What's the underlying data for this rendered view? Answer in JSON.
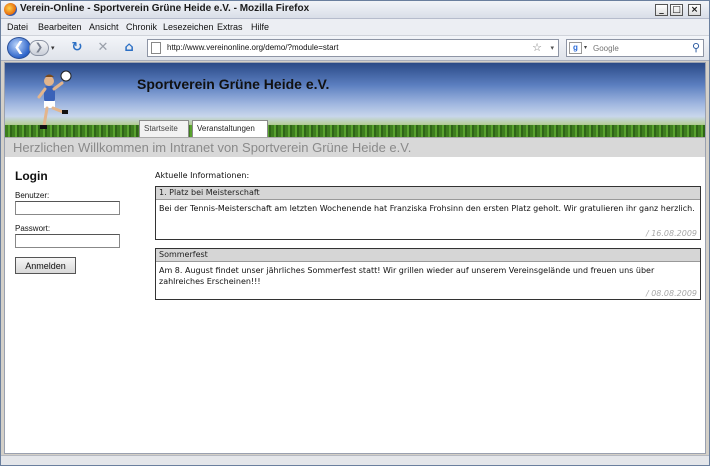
{
  "window": {
    "title": "Verein-Online - Sportverein Grüne Heide e.V. - Mozilla Firefox",
    "controls": {
      "minimize": "_",
      "maximize": "□",
      "close": "×"
    }
  },
  "menu": {
    "items": [
      {
        "label": "Datei"
      },
      {
        "label": "Bearbeiten"
      },
      {
        "label": "Ansicht"
      },
      {
        "label": "Chronik"
      },
      {
        "label": "Lesezeichen"
      },
      {
        "label": "Extras"
      },
      {
        "label": "Hilfe"
      }
    ]
  },
  "toolbar": {
    "back": "❮",
    "forward": "❯",
    "history": "▾",
    "reload": "↻",
    "stop": "✕",
    "home": "⌂",
    "url": "http://www.vereinonline.org/demo/?module=start",
    "bookmark_star": "☆",
    "url_dropdown": "▾",
    "search_engine": "g",
    "search_dropdown": "▾",
    "search_placeholder": "Google",
    "search_icon": "⚲"
  },
  "site": {
    "title": "Sportverein Grüne Heide e.V.",
    "tabs": [
      {
        "label": "Startseite"
      },
      {
        "label": "Veranstaltungen",
        "active": true
      }
    ],
    "welcome": "Herzlichen Willkommen im Intranet von Sportverein Grüne Heide e.V."
  },
  "login": {
    "heading": "Login",
    "user_label": "Benutzer:",
    "password_label": "Passwort:",
    "submit": "Anmelden"
  },
  "news": {
    "heading": "Aktuelle Informationen:",
    "items": [
      {
        "title": "1. Platz bei Meisterschaft",
        "body": "Bei der Tennis-Meisterschaft am letzten Wochenende hat Franziska Frohsinn den ersten Platz geholt. Wir gratulieren ihr ganz herzlich.",
        "date": "/ 16.08.2009"
      },
      {
        "title": "Sommerfest",
        "body": "Am 8. August findet unser jährliches Sommerfest statt! Wir grillen wieder auf unserem Vereinsgelände und freuen uns über zahlreiches Erscheinen!!!",
        "date": "/ 08.08.2009"
      }
    ]
  },
  "colors": {
    "header_top": "#2a4a87",
    "grass": "#4c8a2a",
    "welcome_bar": "#d8d8d8",
    "welcome_text": "#8a8a8a"
  }
}
